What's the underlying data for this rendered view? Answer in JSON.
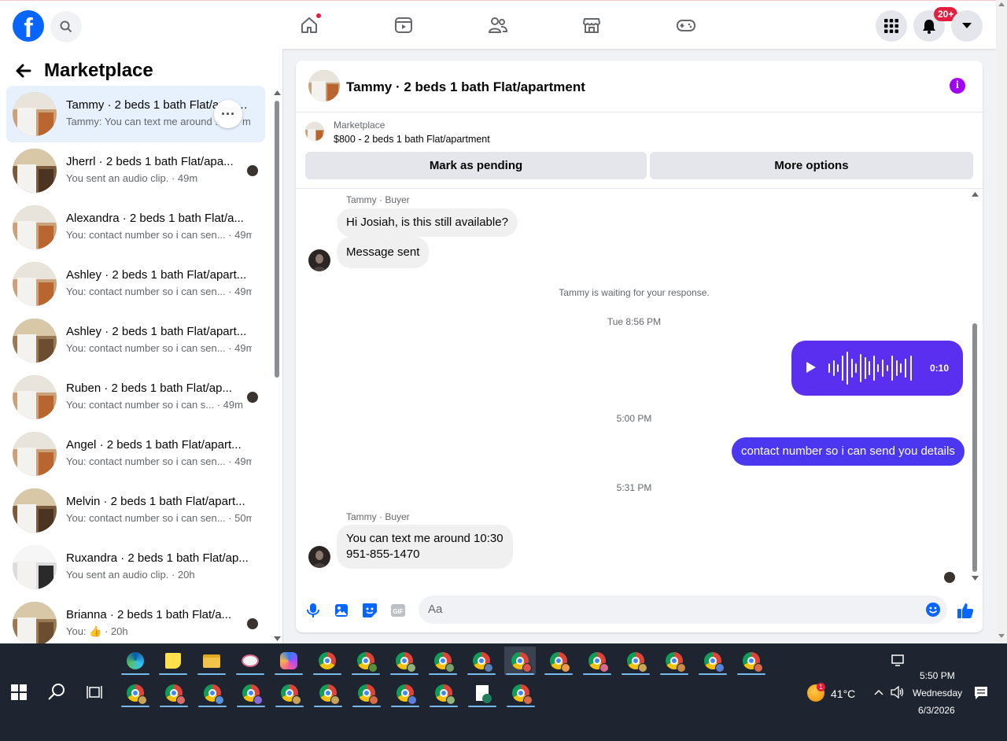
{
  "nav": {
    "logo_letter": "f",
    "notifications_badge": "20+"
  },
  "left": {
    "title": "Marketplace",
    "conversations": [
      {
        "title": "Tammy · 2 beds 1 bath Flat/apartment",
        "sub": "Tammy: You can text me around ...",
        "time": "m"
      },
      {
        "title": "Jherrl · 2 beds 1 bath Flat/apa...",
        "sub": "You sent an audio clip. · 49m"
      },
      {
        "title": "Alexandra · 2 beds 1 bath Flat/a...",
        "sub": "You: contact number so i can sen... · 49m"
      },
      {
        "title": "Ashley · 2 beds 1 bath Flat/apart...",
        "sub": "You: contact number so i can sen... · 49m"
      },
      {
        "title": "Ashley · 2 beds 1 bath Flat/apart...",
        "sub": "You: contact number so i can sen... · 49m"
      },
      {
        "title": "Ruben · 2 beds 1 bath Flat/ap...",
        "sub": "You: contact number so i can s... · 49m"
      },
      {
        "title": "Angel · 2 beds 1 bath Flat/apart...",
        "sub": "You: contact number so i can sen... · 49m"
      },
      {
        "title": "Melvin · 2 beds 1 bath Flat/apart...",
        "sub": "You: contact number so i can sen... · 50m"
      },
      {
        "title": "Ruxandra · 2 beds 1 bath Flat/ap...",
        "sub": "You sent an audio clip. · 20h"
      },
      {
        "title": "Brianna · 2 beds 1 bath Flat/a...",
        "sub": "You: 👍 · 20h"
      }
    ]
  },
  "chat": {
    "title": "Tammy · 2 beds 1 bath Flat/apartment",
    "marketplace_label": "Marketplace",
    "listing": "$800 - 2 beds 1 bath Flat/apartment",
    "mark_pending": "Mark as pending",
    "more_options": "More options",
    "sender1": "Tammy · Buyer",
    "msg1": "Hi Josiah, is this still available?",
    "msg2": "Message sent",
    "waiting": "Tammy is waiting for your response.",
    "time1": "Tue 8:56 PM",
    "audio_duration": "0:10",
    "time2": "5:00 PM",
    "msg_out": "contact number so i can send you details",
    "time3": "5:31 PM",
    "sender2": "Tammy · Buyer",
    "msg3_line1": "You can text me around 10:30",
    "msg3_line2": "951-855-1470",
    "composer_placeholder": "Aa",
    "gif_label": "GIF"
  },
  "taskbar": {
    "weather": "41°C",
    "weather_badge": "1",
    "time": "5:50 PM",
    "day": "Wednesday",
    "date": "6/3/2026"
  },
  "colors": {
    "fb_blue": "#0866ff",
    "outgoing_bubble": "#4c37f0",
    "audio_bubble": "#5b2ff0",
    "info_purple": "#a200f5"
  }
}
